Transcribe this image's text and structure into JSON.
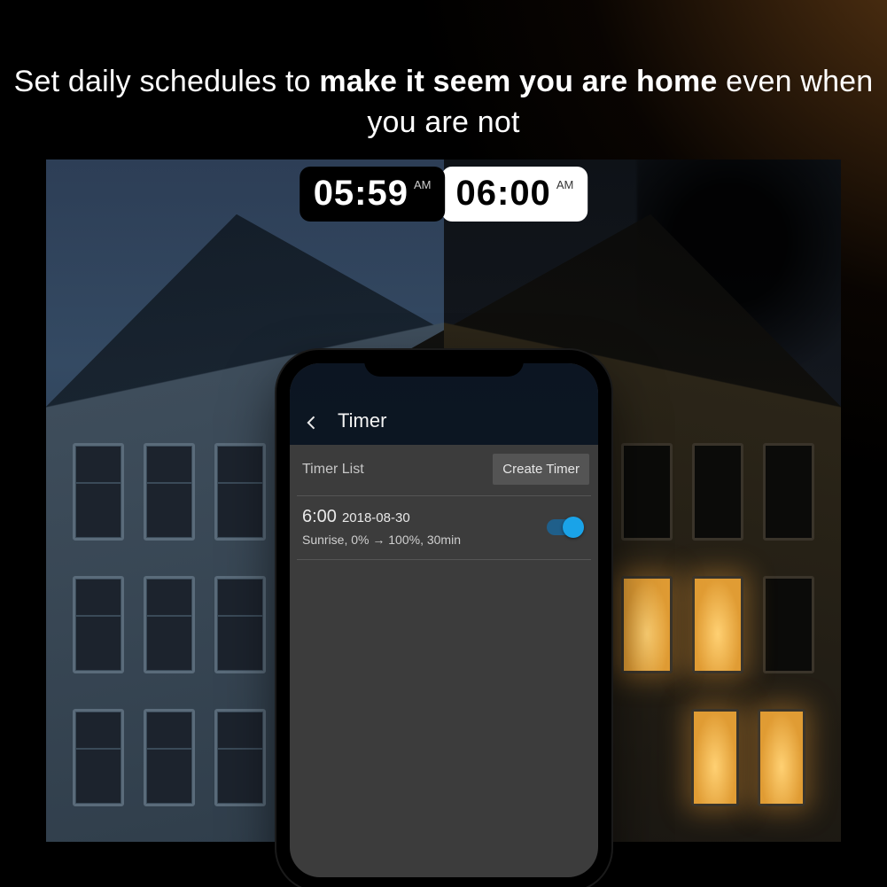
{
  "headline": {
    "part1": "Set daily schedules to ",
    "bold": "make it seem you are home",
    "part2": " even when you are not"
  },
  "time_badges": {
    "left": {
      "time": "05:59",
      "ampm": "AM"
    },
    "right": {
      "time": "06:00",
      "ampm": "AM"
    }
  },
  "app": {
    "title": "Timer",
    "list_label": "Timer List",
    "create_button": "Create Timer",
    "timer": {
      "time": "6:00",
      "date": "2018-08-30",
      "detail": "Sunrise, 0% → 100%, 30min",
      "enabled": true
    }
  },
  "colors": {
    "toggle_on_track": "#1f5f8a",
    "toggle_on_knob": "#1aa3e8"
  }
}
